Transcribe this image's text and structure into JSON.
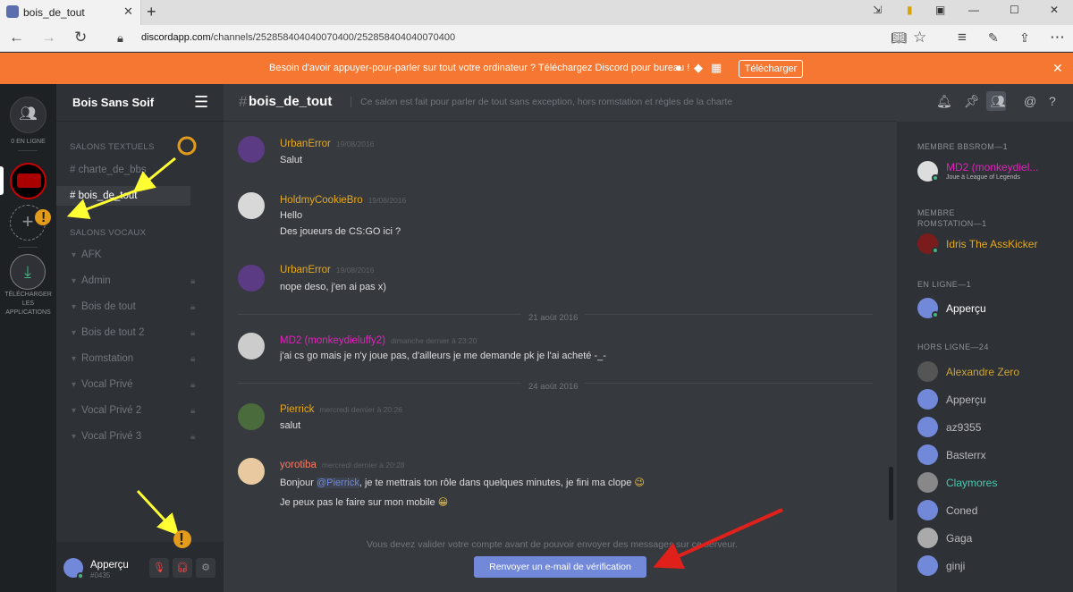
{
  "browser": {
    "tab_title": "bois_de_tout",
    "url_domain": "discordapp.com",
    "url_path": "/channels/252858404040070400/252858404040070400"
  },
  "banner": {
    "message": "Besoin d'avoir appuyer-pour-parler sur tout votre ordinateur ? Téléchargez Discord pour bureau !",
    "button": "Télécharger"
  },
  "servers": {
    "online_label": "0 EN LIGNE",
    "download_label_1": "TÉLÉCHARGER",
    "download_label_2": "LES",
    "download_label_3": "APPLICATIONS"
  },
  "guild": {
    "name": "Bois Sans Soif"
  },
  "channels": {
    "text_header": "SALONS TEXTUELS",
    "text": [
      {
        "name": "charte_de_bbs"
      },
      {
        "name": "bois_de_tout"
      }
    ],
    "voice_header": "SALONS VOCAUX",
    "voice": [
      {
        "name": "AFK"
      },
      {
        "name": "Admin"
      },
      {
        "name": "Bois de tout"
      },
      {
        "name": "Bois de tout 2"
      },
      {
        "name": "Romstation"
      },
      {
        "name": "Vocal Privé"
      },
      {
        "name": "Vocal Privé 2"
      },
      {
        "name": "Vocal Privé 3"
      }
    ]
  },
  "user": {
    "name": "Apperçu",
    "tag": "#0435"
  },
  "channel": {
    "name": "bois_de_tout",
    "topic": "Ce salon est fait pour parler de tout sans exception, hors romstation et règles de la charte"
  },
  "messages": [
    {
      "author": "UrbanError",
      "time": "19/08/2016",
      "lines": [
        "Salut"
      ],
      "color": "#e5a91b"
    },
    {
      "author": "HoldmyCookieBro",
      "time": "19/08/2016",
      "lines": [
        "Hello",
        "Des joueurs de CS:GO ici ?"
      ],
      "color": "#e5a91b"
    },
    {
      "author": "UrbanError",
      "time": "19/08/2016",
      "lines": [
        "nope deso, j'en ai pas x)"
      ],
      "color": "#e5a91b"
    },
    {
      "author": "MD2 (monkeydieluffy2)",
      "time": "dimanche dernier à 23:20",
      "lines": [
        "j'ai cs go mais je n'y joue pas, d'ailleurs je me demande pk je l'ai acheté -_-"
      ],
      "color": "#e91ec1"
    },
    {
      "author": "Pierrick",
      "time": "mercredi dernier à 20:26",
      "lines": [
        "salut"
      ],
      "color": "#e5a91b"
    },
    {
      "author": "yorotiba",
      "time": "mercredi dernier à 20:28",
      "lines": [
        "Bonjour",
        "@Pierrick",
        ", je te mettrais ton rôle dans quelques minutes, je fini ma clope",
        "Je peux pas le faire sur mon mobile"
      ],
      "color": "#f47b67"
    }
  ],
  "dividers": [
    "21 août 2016",
    "24 août 2016"
  ],
  "verify": {
    "message": "Vous devez valider votre compte avant de pouvoir envoyer des messages sur ce serveur.",
    "button": "Renvoyer un e-mail de vérification"
  },
  "members": {
    "groups": [
      {
        "title": "MEMBRE BBSROM—1",
        "items": [
          {
            "name": "MD2 (monkeydiel...",
            "status": "Joue à League of Legends",
            "color": "#e91ec1"
          }
        ]
      },
      {
        "title": "MEMBRE ROMSTATION—1",
        "items": [
          {
            "name": "Idris The AssKicker",
            "color": "#e5a91b"
          }
        ]
      },
      {
        "title": "EN LIGNE—1",
        "items": [
          {
            "name": "Apperçu",
            "color": "#ffffff"
          }
        ]
      },
      {
        "title": "HORS LIGNE—24",
        "items": [
          {
            "name": "Alexandre Zero",
            "color": "#c9a43a"
          },
          {
            "name": "Apperçu",
            "color": "#b9bbbe"
          },
          {
            "name": "az9355",
            "color": "#b9bbbe"
          },
          {
            "name": "Basterrx",
            "color": "#b9bbbe"
          },
          {
            "name": "Claymores",
            "color": "#48c9b0"
          },
          {
            "name": "Coned",
            "color": "#b9bbbe"
          },
          {
            "name": "Gaga",
            "color": "#b9bbbe"
          },
          {
            "name": "ginji",
            "color": "#b9bbbe"
          }
        ]
      }
    ]
  },
  "colors": {
    "accent": "#7289da",
    "banner": "#f57731",
    "online": "#43b581",
    "annotation_arrow_yellow": "#ffff33",
    "annotation_arrow_red": "#e0201b"
  }
}
